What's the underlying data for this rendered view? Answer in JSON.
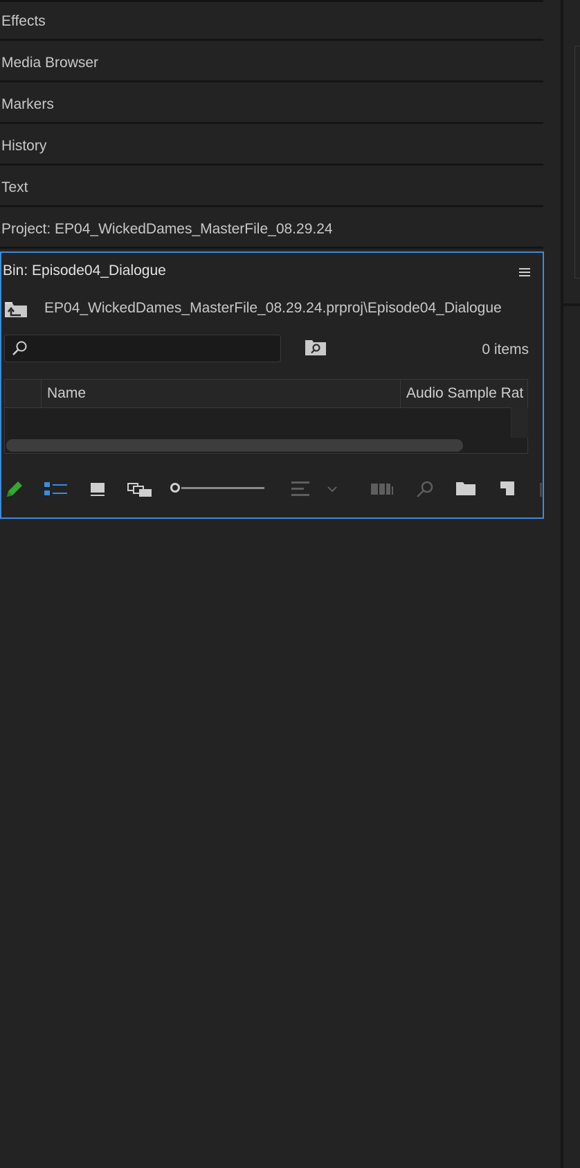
{
  "panels": {
    "tabs": [
      {
        "label": "Effects"
      },
      {
        "label": "Media Browser"
      },
      {
        "label": "Markers"
      },
      {
        "label": "History"
      },
      {
        "label": "Text"
      },
      {
        "label": "Project: EP04_WickedDames_MasterFile_08.29.24"
      }
    ]
  },
  "bin": {
    "title": "Bin: Episode04_Dialogue",
    "path": "EP04_WickedDames_MasterFile_08.29.24.prproj\\Episode04_Dialogue",
    "search": {
      "value": "",
      "placeholder": ""
    },
    "item_count": "0 items",
    "columns": [
      "Name",
      "Audio Sample Rat"
    ],
    "rows": []
  },
  "toolbar": {
    "icons": [
      "pencil-icon",
      "list-view-icon",
      "icon-view-icon",
      "freeform-view-icon",
      "zoom-slider",
      "sort-icon",
      "sort-dropdown-icon",
      "automate-to-sequence-icon",
      "find-icon",
      "new-bin-icon",
      "new-item-icon"
    ]
  },
  "colors": {
    "accent": "#3d8bdc",
    "pencil": "#35a82f",
    "background": "#232323"
  }
}
